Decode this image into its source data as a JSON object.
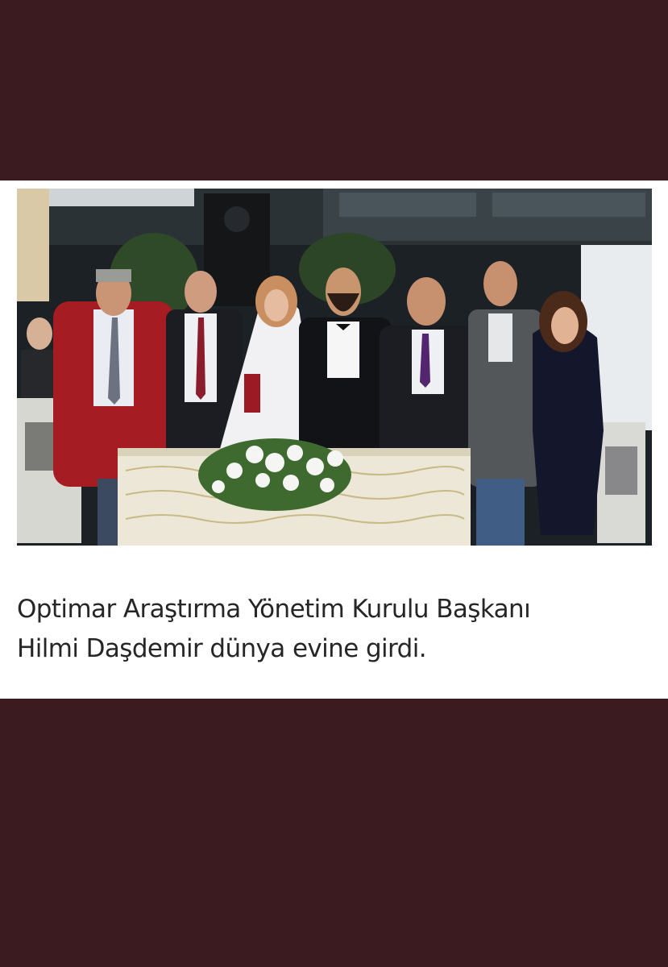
{
  "post": {
    "photo_alt": "",
    "caption_lines": [
      "Optimar Araştırma Yönetim Kurulu Başkanı",
      "Hilmi Daşdemir dünya evine girdi."
    ]
  },
  "colors": {
    "background": "#3b1a20",
    "card": "#ffffff",
    "caption_text": "#262626"
  }
}
